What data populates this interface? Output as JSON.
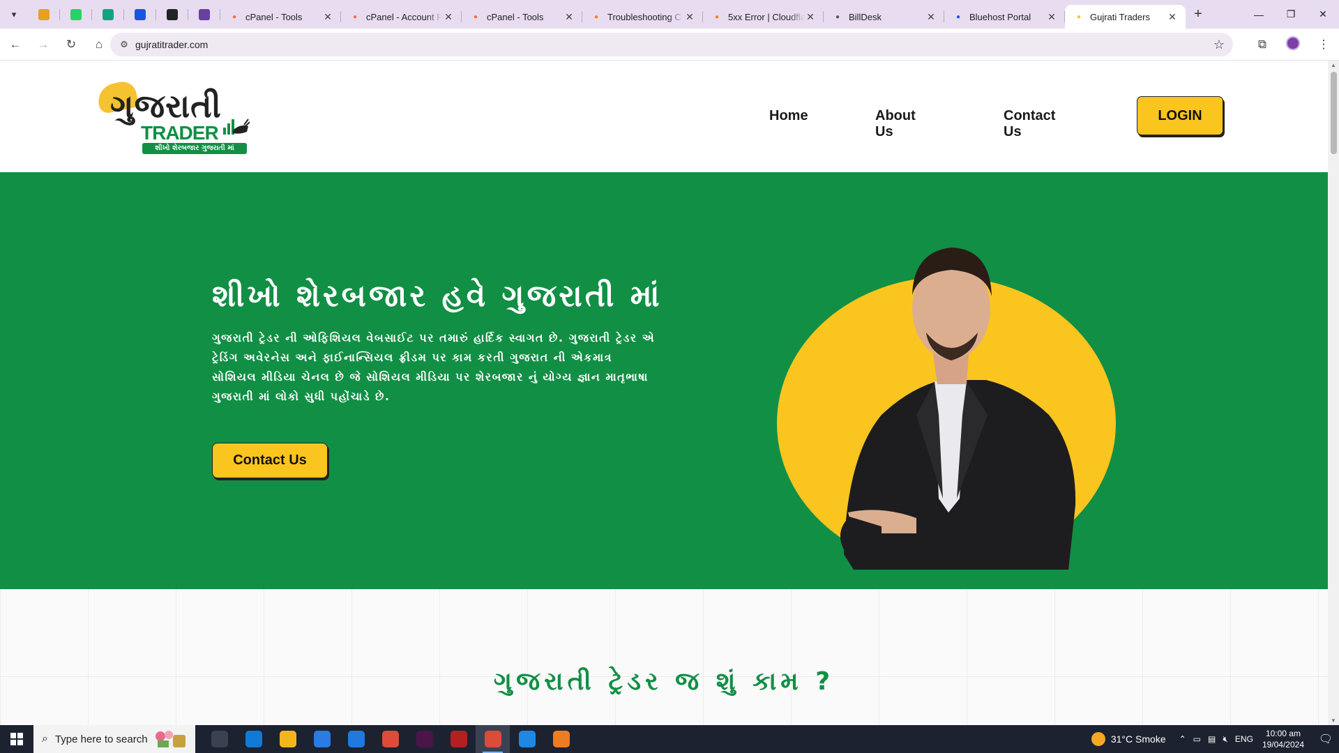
{
  "browser": {
    "pinned_tabs": [
      {
        "icon": "cloud-logo-icon",
        "color": "#e8a020"
      },
      {
        "icon": "whatsapp-icon",
        "color": "#25d366"
      },
      {
        "icon": "chatgpt-icon",
        "color": "#10a37f"
      },
      {
        "icon": "grid-apps-icon",
        "color": "#1a56db"
      },
      {
        "icon": "github-icon",
        "color": "#222222"
      },
      {
        "icon": "slack-icon",
        "color": "#6b3fa0"
      }
    ],
    "tabs": [
      {
        "title": "cPanel - Tools",
        "icon": "cpanel-icon",
        "color": "#ff6c2c",
        "active": false
      },
      {
        "title": "cPanel - Account P",
        "icon": "cpanel-icon",
        "color": "#ff6c2c",
        "active": false
      },
      {
        "title": "cPanel - Tools",
        "icon": "cpanel-icon",
        "color": "#ff6c2c",
        "active": false
      },
      {
        "title": "Troubleshooting C",
        "icon": "cloudflare-icon",
        "color": "#f38020",
        "active": false
      },
      {
        "title": "5xx Error | Cloudfla",
        "icon": "cloudflare-icon",
        "color": "#f38020",
        "active": false
      },
      {
        "title": "BillDesk",
        "icon": "globe-icon",
        "color": "#555555",
        "active": false
      },
      {
        "title": "Bluehost Portal",
        "icon": "bluehost-icon",
        "color": "#1a56db",
        "active": false
      },
      {
        "title": "Gujrati Traders",
        "icon": "gujarati-trader-icon",
        "color": "#f5c230",
        "active": true
      }
    ],
    "url": "gujratitrader.com"
  },
  "site": {
    "logo": {
      "word": "ગુજરાતી",
      "trader": "TRADER",
      "tagline": "શીખો શેરબજાર ગુજરાતી માં"
    },
    "nav": {
      "home": "Home",
      "about": "About Us",
      "contact": "Contact Us",
      "login": "LOGIN"
    },
    "hero": {
      "title": "શીખો શેરબજાર હવે ગુજરાતી માં",
      "description": "ગુજરાતી ટ્રેડર ની ઓફિશિયલ વેબસાઈટ પર તમારું હાર્દિક સ્વાગત છે. ગુજરાતી ટ્રેડર એ ટ્રેડિંગ અવેરનેસ અને ફાઈનાન્સિયલ ફ્રીડમ પર કામ કરતી ગુજરાત ની એકમાત્ર સોશિયલ મીડિયા ચેનલ છે જે સોશિયલ મીડિયા પર શેરબજાર નું યોગ્ય જ્ઞાન માતૃભાષા ગુજરાતી માં લોકો સુધી પહોંચાડે છે.",
      "cta": "Contact Us"
    },
    "section2": {
      "title": "ગુજરાતી ટ્રેડર જ શું કામ ?"
    },
    "colors": {
      "green": "#118f45",
      "yellow": "#fbc51f"
    }
  },
  "taskbar": {
    "search_placeholder": "Type here to search",
    "apps": [
      {
        "icon": "task-view-icon",
        "color": "#3a4152"
      },
      {
        "icon": "edge-icon",
        "color": "#0f7bd6"
      },
      {
        "icon": "file-explorer-icon",
        "color": "#f2b61c"
      },
      {
        "icon": "microsoft-store-icon",
        "color": "#2a7be4"
      },
      {
        "icon": "mail-icon",
        "color": "#1f7ae0"
      },
      {
        "icon": "chrome-icon",
        "color": "#dd4b39"
      },
      {
        "icon": "slack-icon",
        "color": "#4a154b"
      },
      {
        "icon": "filezilla-icon",
        "color": "#b32020"
      },
      {
        "icon": "chrome-profile-icon",
        "color": "#dd4b39",
        "active": true
      },
      {
        "icon": "vscode-icon",
        "color": "#1e88e5"
      },
      {
        "icon": "xampp-icon",
        "color": "#f07c21"
      }
    ],
    "weather": "31°C  Smoke",
    "language": "ENG",
    "time": "10:00 am",
    "date": "19/04/2024"
  }
}
